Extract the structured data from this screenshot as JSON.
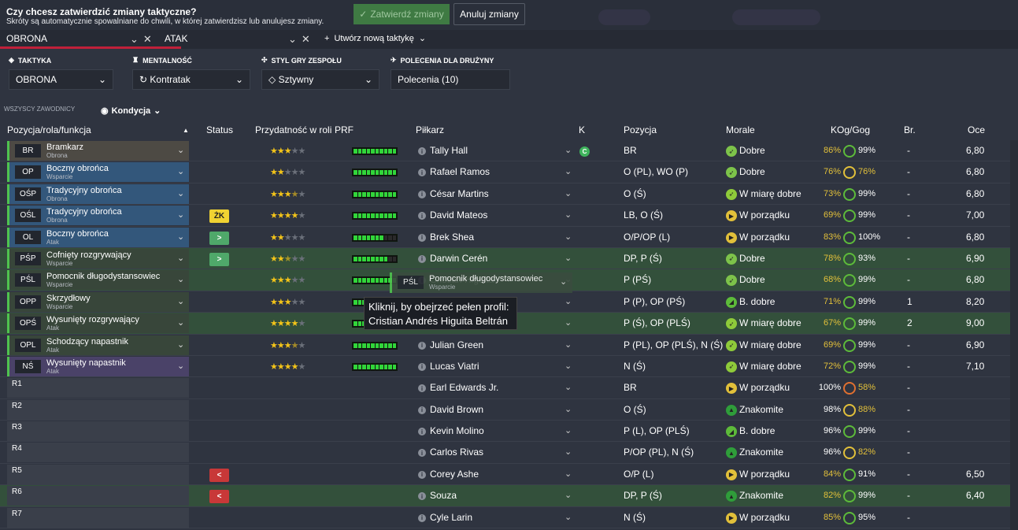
{
  "confirm_bar": {
    "title": "Czy chcesz zatwierdzić zmiany taktyczne?",
    "subtitle": "Skróty są automatycznie spowalniane do chwili, w której zatwierdzisz lub anulujesz zmiany.",
    "confirm_label": "Zatwierdź zmiany",
    "cancel_label": "Anuluj zmiany"
  },
  "tactic_tabs": {
    "tab1": "OBRONA",
    "tab2": "ATAK",
    "new_tactic": "Utwórz nową taktykę"
  },
  "settings": {
    "tactic_label": "Taktyka",
    "tactic_value": "OBRONA",
    "mentality_label": "Mentalność",
    "mentality_value": "Kontratak",
    "style_label": "Styl gry zespołu",
    "style_value": "Sztywny",
    "instructions_label": "Polecenia dla drużyny",
    "instructions_value": "Polecenia (10)"
  },
  "filter": {
    "all_players": "WSZYSCY ZAWODNICY",
    "view": "Kondycja"
  },
  "columns": {
    "position": "Pozycja/rola/funkcja",
    "status": "Status",
    "suitability": "Przydatność w roli",
    "prf": "PRF",
    "player": "Piłkarz",
    "k": "K",
    "pos": "Pozycja",
    "morale": "Morale",
    "kog": "KOg/Gog",
    "br": "Br.",
    "oce": "Oce"
  },
  "rows": [
    {
      "code": "BR",
      "role": "Bramkarz",
      "duty": "Obrona",
      "status": "",
      "stars": 3,
      "prf": 10,
      "player": "Tally Hall",
      "k": "C",
      "pos": "BR",
      "morale": "Dobre",
      "kog": "86%",
      "gog": "99%",
      "br": "-",
      "oce": "6,80"
    },
    {
      "code": "OP",
      "role": "Boczny obrońca",
      "duty": "Wsparcie",
      "status": "",
      "stars": 2,
      "prf": 10,
      "player": "Rafael Ramos",
      "k": "",
      "pos": "O (PL), WO (P)",
      "morale": "Dobre",
      "kog": "76%",
      "gog": "76%",
      "br": "-",
      "oce": "6,80"
    },
    {
      "code": "OŚP",
      "role": "Tradycyjny obrońca",
      "duty": "Obrona",
      "status": "",
      "stars": 3.5,
      "prf": 10,
      "player": "César Martins",
      "k": "",
      "pos": "O (Ś)",
      "morale": "W miarę dobre",
      "kog": "73%",
      "gog": "99%",
      "br": "-",
      "oce": "6,80"
    },
    {
      "code": "OŚL",
      "role": "Tradycyjny obrońca",
      "duty": "Obrona",
      "status": "ŻK",
      "stars": 4,
      "prf": 10,
      "player": "David Mateos",
      "k": "",
      "pos": "LB, O (Ś)",
      "morale": "W porządku",
      "kog": "69%",
      "gog": "99%",
      "br": "-",
      "oce": "7,00"
    },
    {
      "code": "OL",
      "role": "Boczny obrońca",
      "duty": "Atak",
      "status": ">",
      "stars": 2,
      "prf": 7,
      "player": "Brek Shea",
      "k": "",
      "pos": "O/P/OP (L)",
      "morale": "W porządku",
      "kog": "83%",
      "gog": "100%",
      "br": "-",
      "oce": "6,80"
    },
    {
      "code": "PŚP",
      "role": "Cofnięty rozgrywający",
      "duty": "Wsparcie",
      "status": ">",
      "stars": 2.5,
      "prf": 8,
      "player": "Darwin Cerén",
      "k": "",
      "pos": "DP, P (Ś)",
      "morale": "Dobre",
      "kog": "78%",
      "gog": "93%",
      "br": "-",
      "oce": "6,90"
    },
    {
      "code": "PŚL",
      "role": "Pomocnik długodystansowiec",
      "duty": "Wsparcie",
      "status": "",
      "stars": 3,
      "prf": 10,
      "player": "Cristian Higuita",
      "k": "",
      "pos": "P (PŚ)",
      "morale": "Dobre",
      "kog": "68%",
      "gog": "99%",
      "br": "-",
      "oce": "6,80"
    },
    {
      "code": "OPP",
      "role": "Skrzydłowy",
      "duty": "Wsparcie",
      "status": "",
      "stars": 3,
      "prf": 10,
      "player": "",
      "k": "",
      "pos": "P (P), OP (PŚ)",
      "morale": "B. dobre",
      "kog": "71%",
      "gog": "99%",
      "br": "1",
      "oce": "8,20"
    },
    {
      "code": "OPŚ",
      "role": "Wysunięty rozgrywający",
      "duty": "Atak",
      "status": "",
      "stars": 4,
      "prf": 10,
      "player": "",
      "k": "",
      "pos": "P (Ś), OP (PLŚ)",
      "morale": "W miarę dobre",
      "kog": "67%",
      "gog": "99%",
      "br": "2",
      "oce": "9,00"
    },
    {
      "code": "OPL",
      "role": "Schodzący napastnik",
      "duty": "Atak",
      "status": "",
      "stars": 3.5,
      "prf": 10,
      "player": "Julian Green",
      "k": "",
      "pos": "P (PL), OP (PLŚ), N (Ś)",
      "morale": "W miarę dobre",
      "kog": "69%",
      "gog": "99%",
      "br": "-",
      "oce": "6,90"
    },
    {
      "code": "NŚ",
      "role": "Wysunięty napastnik",
      "duty": "Atak",
      "status": "",
      "stars": 4,
      "prf": 10,
      "player": "Lucas Viatri",
      "k": "",
      "pos": "N (Ś)",
      "morale": "W miarę dobre",
      "kog": "72%",
      "gog": "99%",
      "br": "-",
      "oce": "7,10"
    },
    {
      "code": "R1",
      "role": "",
      "duty": "",
      "status": "",
      "stars": 0,
      "prf": 0,
      "player": "Earl Edwards Jr.",
      "k": "",
      "pos": "BR",
      "morale": "W porządku",
      "kog": "100%",
      "gog": "58%",
      "br": "-",
      "oce": ""
    },
    {
      "code": "R2",
      "role": "",
      "duty": "",
      "status": "",
      "stars": 0,
      "prf": 0,
      "player": "David Brown",
      "k": "",
      "pos": "O (Ś)",
      "morale": "Znakomite",
      "kog": "98%",
      "gog": "88%",
      "br": "-",
      "oce": ""
    },
    {
      "code": "R3",
      "role": "",
      "duty": "",
      "status": "",
      "stars": 0,
      "prf": 0,
      "player": "Kevin Molino",
      "k": "",
      "pos": "P (L), OP (PLŚ)",
      "morale": "B. dobre",
      "kog": "96%",
      "gog": "99%",
      "br": "-",
      "oce": ""
    },
    {
      "code": "R4",
      "role": "",
      "duty": "",
      "status": "",
      "stars": 0,
      "prf": 0,
      "player": "Carlos Rivas",
      "k": "",
      "pos": "P/OP (PL), N (Ś)",
      "morale": "Znakomite",
      "kog": "96%",
      "gog": "82%",
      "br": "-",
      "oce": ""
    },
    {
      "code": "R5",
      "role": "",
      "duty": "",
      "status": "<",
      "stars": 0,
      "prf": 0,
      "player": "Corey Ashe",
      "k": "",
      "pos": "O/P (L)",
      "morale": "W porządku",
      "kog": "84%",
      "gog": "91%",
      "br": "-",
      "oce": "6,50"
    },
    {
      "code": "R6",
      "role": "",
      "duty": "",
      "status": "<",
      "stars": 0,
      "prf": 0,
      "player": "Souza",
      "k": "",
      "pos": "DP, P (Ś)",
      "morale": "Znakomite",
      "kog": "82%",
      "gog": "99%",
      "br": "-",
      "oce": "6,40"
    },
    {
      "code": "R7",
      "role": "",
      "duty": "",
      "status": "",
      "stars": 0,
      "prf": 0,
      "player": "Cyle Larin",
      "k": "",
      "pos": "N (Ś)",
      "morale": "W porządku",
      "kog": "85%",
      "gog": "95%",
      "br": "-",
      "oce": ""
    }
  ],
  "drag_overlay": {
    "code": "PŚL",
    "role": "Pomocnik długodystansowiec",
    "duty": "Wsparcie"
  },
  "tooltip": {
    "line1": "Kliknij, by obejrzeć pełen profil:",
    "line2": "Cristian Andrés Higuita Beltrán"
  },
  "colors": {
    "accent_red": "#c0203a",
    "prf_green": "#31d63a",
    "star": "#f3c419",
    "morale_good": "#7dc34a",
    "morale_ok": "#e2c03a",
    "morale_great": "#2f9d3a"
  }
}
